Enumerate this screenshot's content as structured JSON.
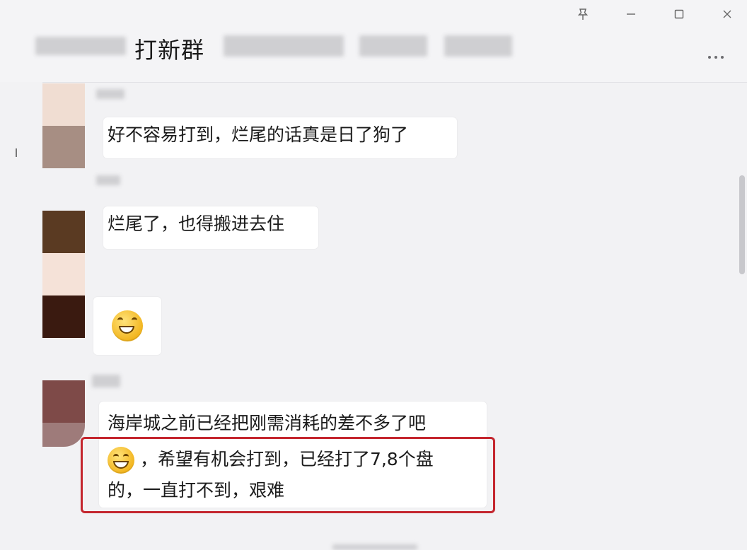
{
  "window": {
    "title": "打新群",
    "controls": [
      "pin-icon",
      "minimize-icon",
      "maximize-icon",
      "close-icon"
    ]
  },
  "header": {
    "more_icon": "more-options-icon"
  },
  "messages": [
    {
      "text": "好不容易打到，烂尾的话真是日了狗了"
    },
    {
      "text": "烂尾了，也得搬进去住"
    },
    {
      "emoji": "grinning-face-emoji"
    },
    {
      "line1": "海岸城之前已经把刚需消耗的差不多了吧",
      "line2": "，希望有机会打到，已经打了7,8个盘",
      "line3": "的，一直打不到，艰难",
      "emoji": "crying-laughing-emoji"
    }
  ],
  "colors": {
    "highlight": "#c4262e",
    "bubble": "#ffffff",
    "background": "#f2f2f4"
  }
}
